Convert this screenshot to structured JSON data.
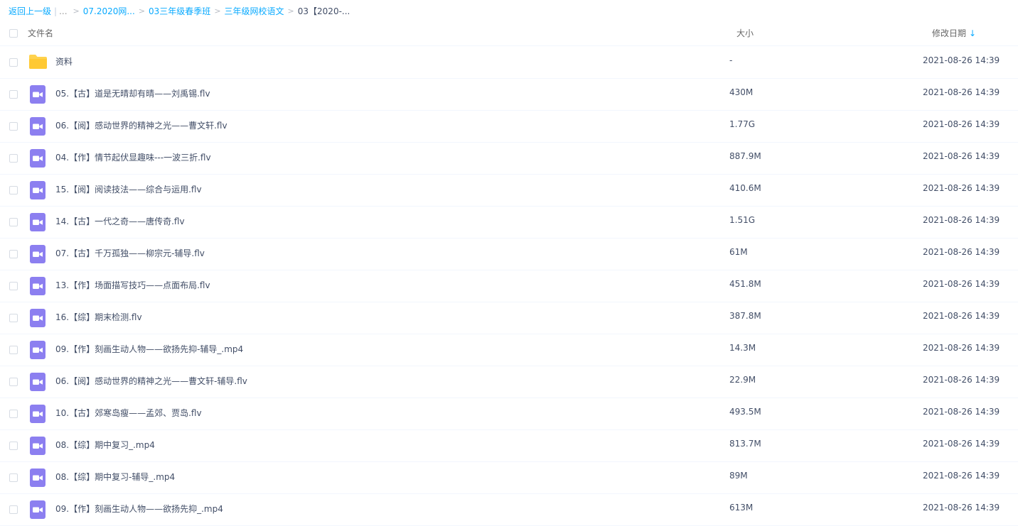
{
  "breadcrumb": {
    "back": "返回上一级",
    "pipe": "|",
    "more": "...",
    "crumbs": [
      "07.2020网...",
      "03三年级春季班",
      "三年级网校语文"
    ],
    "separator": ">",
    "current": "03【2020-..."
  },
  "header": {
    "name": "文件名",
    "size": "大小",
    "date": "修改日期",
    "sort_icon": "arrow-down-icon",
    "sort_glyph": "↓"
  },
  "colors": {
    "accent": "#09aaff",
    "folder": "#ffd24d",
    "video": "#8c7ff0",
    "text": "#424e67"
  },
  "files": [
    {
      "type": "folder",
      "name": "资料",
      "size": "-",
      "date": "2021-08-26 14:39"
    },
    {
      "type": "video",
      "name": "05.【古】道是无晴却有晴——刘禹锡.flv",
      "size": "430M",
      "date": "2021-08-26 14:39"
    },
    {
      "type": "video",
      "name": "06.【阅】感动世界的精神之光——曹文轩.flv",
      "size": "1.77G",
      "date": "2021-08-26 14:39"
    },
    {
      "type": "video",
      "name": "04.【作】情节起伏显趣味---一波三折.flv",
      "size": "887.9M",
      "date": "2021-08-26 14:39"
    },
    {
      "type": "video",
      "name": "15.【阅】阅读技法——综合与运用.flv",
      "size": "410.6M",
      "date": "2021-08-26 14:39"
    },
    {
      "type": "video",
      "name": "14.【古】一代之奇——唐传奇.flv",
      "size": "1.51G",
      "date": "2021-08-26 14:39"
    },
    {
      "type": "video",
      "name": "07.【古】千万孤独——柳宗元-辅导.flv",
      "size": "61M",
      "date": "2021-08-26 14:39"
    },
    {
      "type": "video",
      "name": "13.【作】场面描写技巧——点面布局.flv",
      "size": "451.8M",
      "date": "2021-08-26 14:39"
    },
    {
      "type": "video",
      "name": "16.【综】期末检测.flv",
      "size": "387.8M",
      "date": "2021-08-26 14:39"
    },
    {
      "type": "video",
      "name": "09.【作】刻画生动人物——欲扬先抑-辅导_.mp4",
      "size": "14.3M",
      "date": "2021-08-26 14:39"
    },
    {
      "type": "video",
      "name": "06.【阅】感动世界的精神之光——曹文轩-辅导.flv",
      "size": "22.9M",
      "date": "2021-08-26 14:39"
    },
    {
      "type": "video",
      "name": "10.【古】郊寒岛瘦——孟郊、贾岛.flv",
      "size": "493.5M",
      "date": "2021-08-26 14:39"
    },
    {
      "type": "video",
      "name": "08.【综】期中复习_.mp4",
      "size": "813.7M",
      "date": "2021-08-26 14:39"
    },
    {
      "type": "video",
      "name": "08.【综】期中复习-辅导_.mp4",
      "size": "89M",
      "date": "2021-08-26 14:39"
    },
    {
      "type": "video",
      "name": "09.【作】刻画生动人物——欲扬先抑_.mp4",
      "size": "613M",
      "date": "2021-08-26 14:39"
    }
  ]
}
